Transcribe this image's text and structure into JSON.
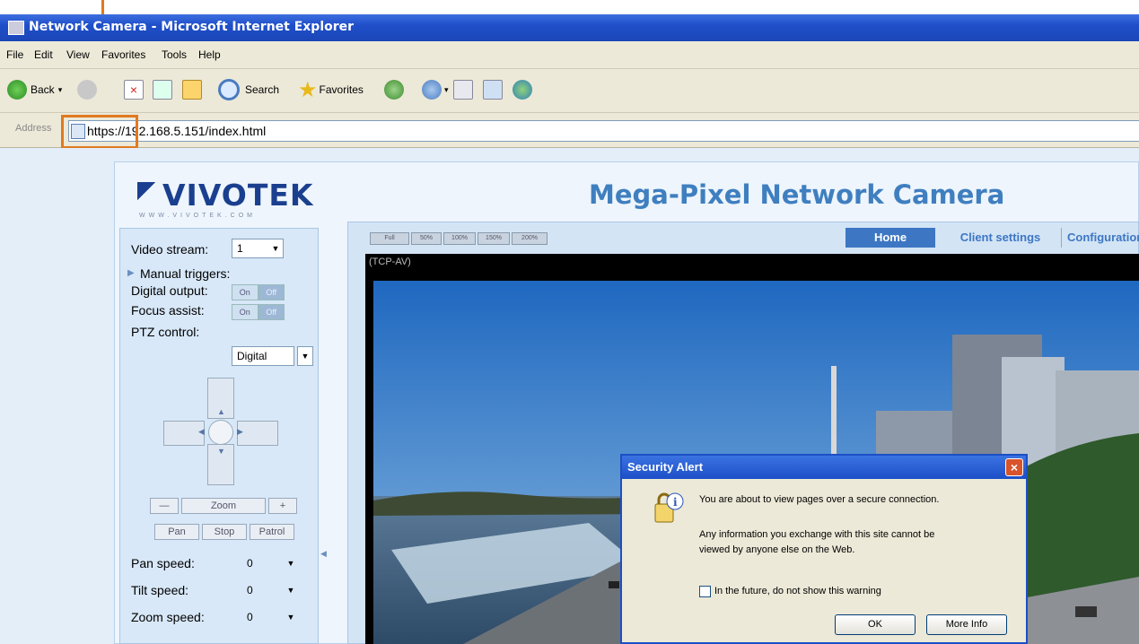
{
  "window": {
    "title": "Network Camera - Microsoft Internet Explorer"
  },
  "menu": [
    "File",
    "Edit",
    "View",
    "Favorites",
    "Tools",
    "Help"
  ],
  "toolbar": {
    "back": "Back",
    "search": "Search",
    "favorites": "Favorites"
  },
  "address": {
    "label": "Address",
    "url": "https://192.168.5.151/index.html"
  },
  "brand": {
    "logo": "VIVOTEK",
    "tagline": "WWW.VIVOTEK.COM",
    "heading": "Mega-Pixel Network Camera"
  },
  "left_panel": {
    "video_stream_label": "Video stream:",
    "video_stream_value": "1",
    "manual_triggers": "Manual triggers:",
    "digital_output": "Digital output:",
    "focus_assist": "Focus assist:",
    "on": "On",
    "off": "Off",
    "ptz_control_label": "PTZ control:",
    "ptz_control_value": "Digital",
    "zoom": "Zoom",
    "zoom_out": "—",
    "zoom_in": "+",
    "pan": "Pan",
    "stop": "Stop",
    "patrol": "Patrol",
    "pan_speed_label": "Pan speed:",
    "pan_speed_value": "0",
    "tilt_speed_label": "Tilt speed:",
    "tilt_speed_value": "0",
    "zoom_speed_label": "Zoom speed:",
    "zoom_speed_value": "0"
  },
  "view": {
    "size_buttons": [
      "Full",
      "50%",
      "100%",
      "150%",
      "200%"
    ],
    "tabs": {
      "home": "Home",
      "client_settings": "Client settings",
      "configuration": "Configuration"
    },
    "stream_label": "(TCP-AV)"
  },
  "dialog": {
    "title": "Security Alert",
    "line1": "You are about to view pages over a secure connection.",
    "line2": "Any information you exchange with this site cannot be",
    "line3": "viewed by anyone else on the Web.",
    "checkbox_label": "In the future, do not show this warning",
    "ok": "OK",
    "more_info": "More Info"
  },
  "colors": {
    "accent_blue": "#1f4fc9",
    "highlight_orange": "#e07a20",
    "tab_active": "#3d77c4"
  }
}
